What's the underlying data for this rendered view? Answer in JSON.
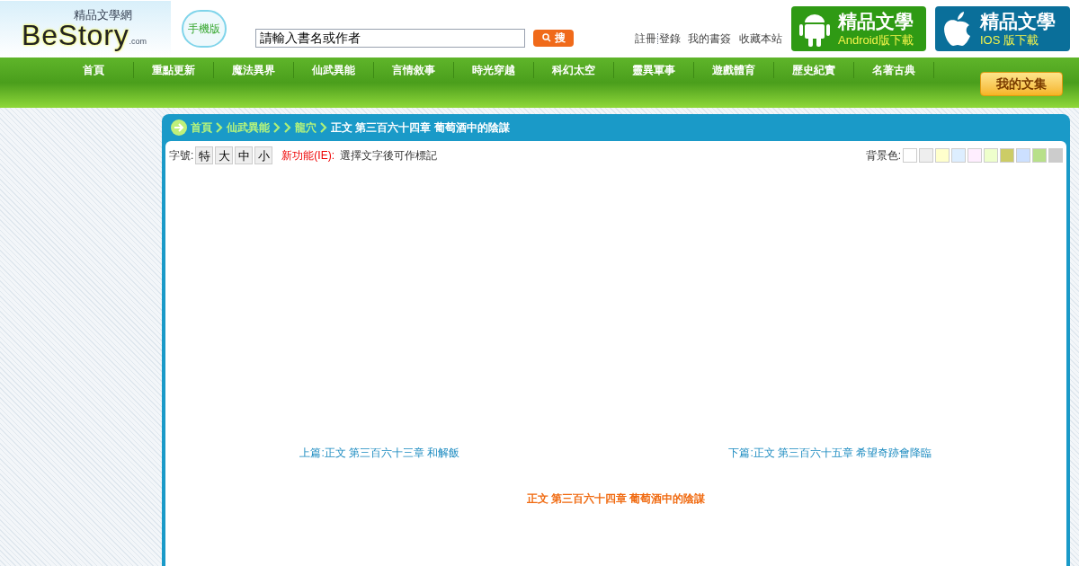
{
  "logo": {
    "subtitle": "精品文學網",
    "name": "BeStory",
    "suffix": ".com"
  },
  "mobile_badge": "手機版",
  "search": {
    "placeholder": "請輸入書名或作者",
    "button": "搜"
  },
  "top_links": [
    "註冊",
    "登錄",
    "我的書簽",
    "收藏本站"
  ],
  "app_buttons": [
    {
      "kind": "android",
      "title": "精品文學",
      "subtitle": "Android版下載"
    },
    {
      "kind": "ios",
      "title": "精品文學",
      "subtitle": "IOS 版下載"
    }
  ],
  "nav": [
    "首頁",
    "重點更新",
    "魔法異界",
    "仙武異能",
    "言情敘事",
    "時光穿越",
    "科幻太空",
    "靈異軍事",
    "遊戲體育",
    "歷史紀實",
    "名著古典"
  ],
  "my_collection": "我的文集",
  "breadcrumb": [
    {
      "kind": "link",
      "label": "首頁"
    },
    {
      "kind": "link",
      "label": "仙武異能"
    },
    {
      "kind": "blank"
    },
    {
      "kind": "link",
      "label": "龍穴"
    }
  ],
  "breadcrumb_current": "正文 第三百六十四章 葡萄酒中的陰謀",
  "font_size": {
    "label": "字號:",
    "options": [
      "特",
      "大",
      "中",
      "小"
    ]
  },
  "notice": {
    "label": "新功能(IE):",
    "text": "選擇文字後可作標記"
  },
  "background": {
    "label": "背景色:",
    "swatches": [
      {
        "color": "#ffffff"
      },
      {
        "color": "#eeeeee"
      },
      {
        "color": "#ffffcc"
      },
      {
        "color": "#ddeeff"
      },
      {
        "color": "#ffeeff"
      },
      {
        "color": "#eeffcc"
      },
      {
        "color": "#cccc66"
      },
      {
        "color": "#cce0ff"
      },
      {
        "color": "#b8e08a"
      },
      {
        "color": "#cccccc"
      }
    ]
  },
  "prev": "上篇:正文 第三百六十三章 和解飯",
  "next": "下篇:正文 第三百六十五章 希望奇跡會降臨",
  "chapter_title": "正文 第三百六十四章 葡萄酒中的陰謀"
}
